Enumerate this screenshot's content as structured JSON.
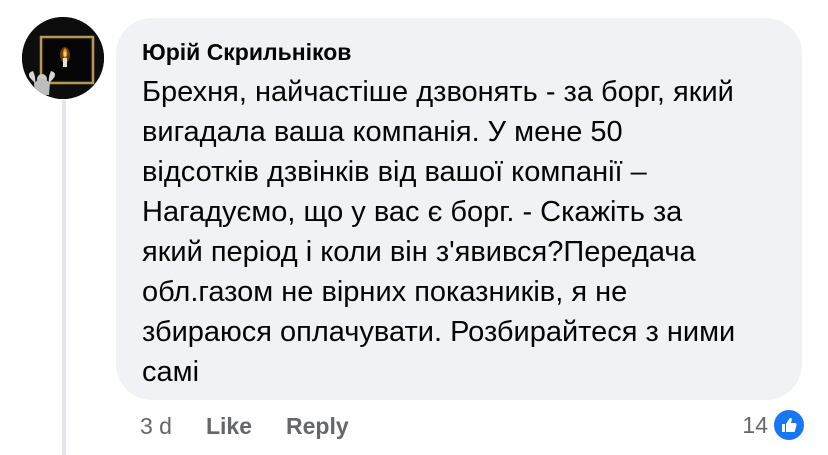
{
  "comment": {
    "author": "Юрій Скрильніков",
    "text": "Брехня, найчастіше дзвонять - за борг, який\nвигадала ваша компанія. У мене 50\nвідсотків дзвінків від вашої компанії –\nНагадуємо, що у вас є борг. - Скажіть за\nякий період і коли він з'явився?Передача\nобл.газом не вірних показників, я не\nзбираюся оплачувати. Розбирайтеся з ними\nсамі"
  },
  "actions": {
    "timestamp": "3 d",
    "like_label": "Like",
    "reply_label": "Reply"
  },
  "reactions": {
    "count": "14",
    "icon": "like-thumb-icon",
    "color": "#1877f2"
  },
  "avatar": {
    "icon": "candle-icon"
  },
  "colors": {
    "bubble": "#f0f2f5",
    "text": "#050505",
    "secondary": "#65676b",
    "accent": "#1877f2"
  }
}
